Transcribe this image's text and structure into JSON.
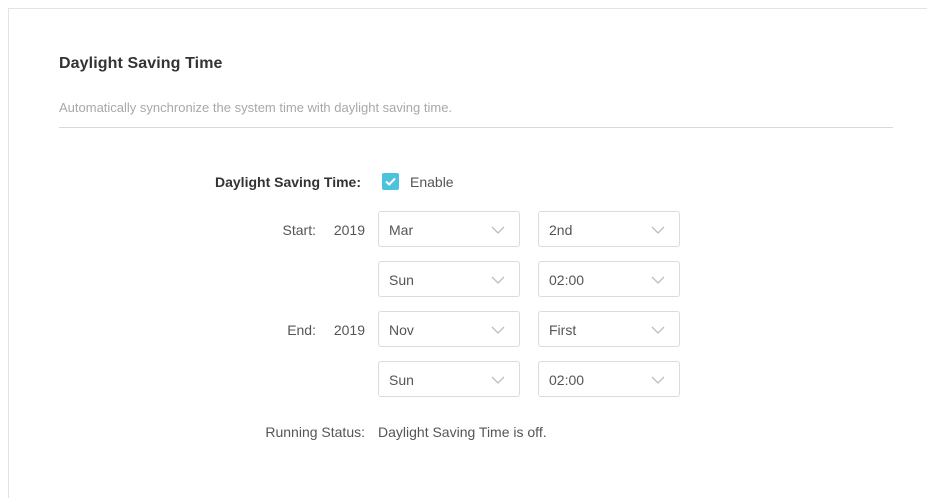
{
  "section": {
    "title": "Daylight Saving Time",
    "description": "Automatically synchronize the system time with daylight saving time."
  },
  "form": {
    "dst_label": "Daylight Saving Time:",
    "enable_label": "Enable",
    "enable_checked": true,
    "start_label": "Start:",
    "start_year": "2019",
    "start_month": "Mar",
    "start_week": "2nd",
    "start_day": "Sun",
    "start_time": "02:00",
    "end_label": "End:",
    "end_year": "2019",
    "end_month": "Nov",
    "end_week": "First",
    "end_day": "Sun",
    "end_time": "02:00",
    "status_label": "Running Status:",
    "status_value": "Daylight Saving Time is off."
  },
  "colors": {
    "accent": "#4cc3dc",
    "border": "#dcdcdc",
    "text": "#555555"
  }
}
